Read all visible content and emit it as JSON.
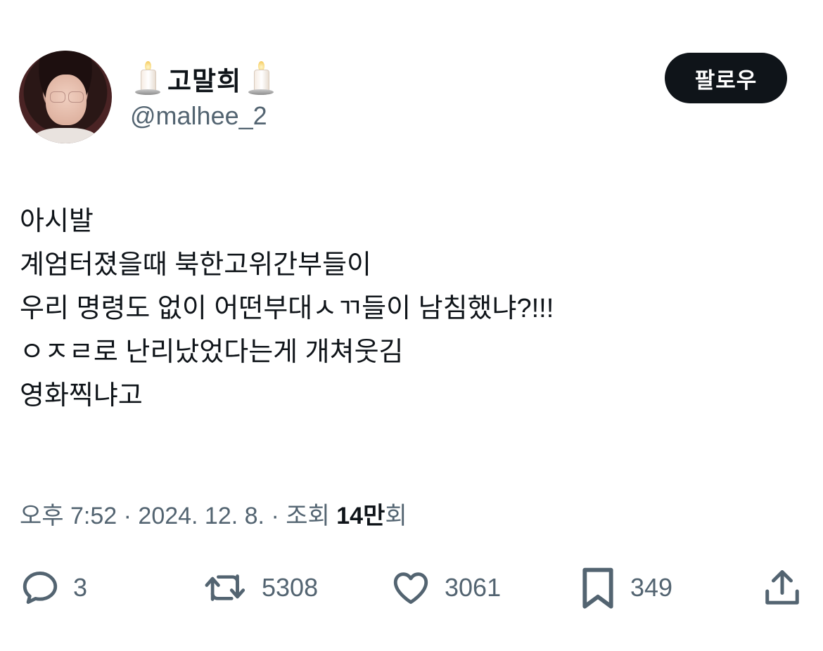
{
  "user": {
    "display_name": "고말희",
    "handle": "@malhee_2",
    "name_emoji": "candle-icon"
  },
  "follow_label": "팔로우",
  "tweet": {
    "lines": [
      "아시발",
      "계엄터졌을때 북한고위간부들이",
      "우리 명령도 없이 어떤부대ㅅㄲ들이 남침했냐?!!!",
      "ㅇㅈㄹ로 난리났었다는게 개쳐웃김",
      "영화찍냐고"
    ]
  },
  "meta": {
    "time": "오후 7:52",
    "separator": " · ",
    "date": "2024. 12. 8.",
    "views_label": "조회",
    "views_count": "14만",
    "views_suffix": "회"
  },
  "actions": {
    "reply_count": "3",
    "retweet_count": "5308",
    "like_count": "3061",
    "bookmark_count": "349"
  }
}
